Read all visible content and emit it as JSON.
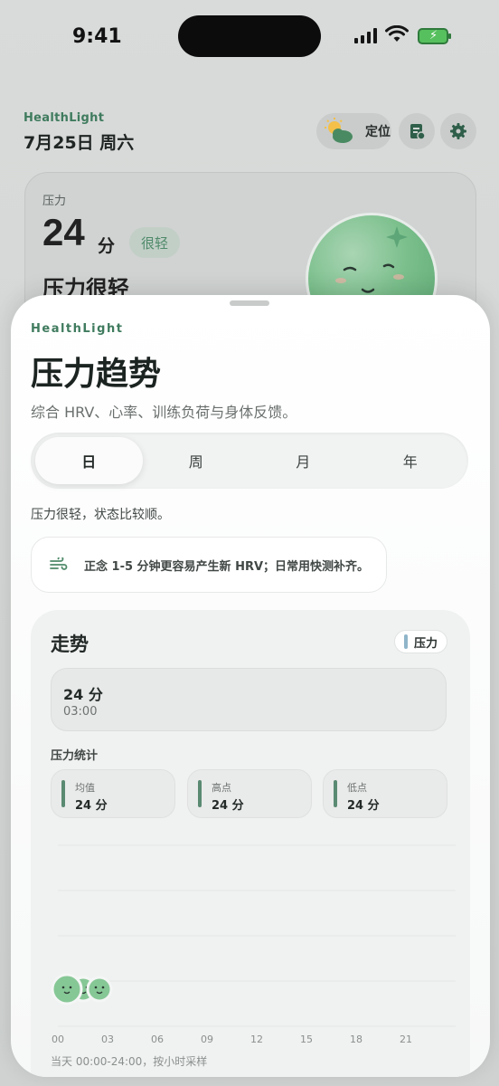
{
  "status": {
    "time": "9:41"
  },
  "background": {
    "brand": "HealthLight",
    "date": "7月25日 周六",
    "location_label": "定位",
    "stress_card": {
      "label": "压力",
      "score": "24",
      "unit": "分",
      "tag": "很轻",
      "state": "压力很轻"
    }
  },
  "sheet": {
    "brand": "HealthLight",
    "title": "压力趋势",
    "subtitle": "综合 HRV、心率、训练负荷与身体反馈。",
    "tabs": [
      {
        "label": "日",
        "active": true
      },
      {
        "label": "周",
        "active": false
      },
      {
        "label": "月",
        "active": false
      },
      {
        "label": "年",
        "active": false
      }
    ],
    "status_text": "压力很轻，状态比较顺。",
    "tip": "正念 1-5 分钟更容易产生新 HRV；日常用快测补齐。",
    "trend": {
      "title": "走势",
      "legend": "压力",
      "readout": {
        "value": "24 分",
        "time": "03:00"
      },
      "stats_title": "压力统计",
      "stats": [
        {
          "key": "均值",
          "value": "24 分"
        },
        {
          "key": "高点",
          "value": "24 分"
        },
        {
          "key": "低点",
          "value": "24 分"
        }
      ],
      "footnote": "当天 00:00-24:00，按小时采样"
    }
  },
  "chart_data": {
    "type": "scatter",
    "x": [
      "00",
      "03",
      "06",
      "09",
      "12",
      "15",
      "18",
      "21"
    ],
    "points": [
      {
        "hour": 1,
        "value": 24
      },
      {
        "hour": 2,
        "value": 24
      },
      {
        "hour": 3,
        "value": 24
      }
    ],
    "xlim": [
      0,
      24
    ],
    "ylim": [
      0,
      100
    ],
    "grid": true
  }
}
